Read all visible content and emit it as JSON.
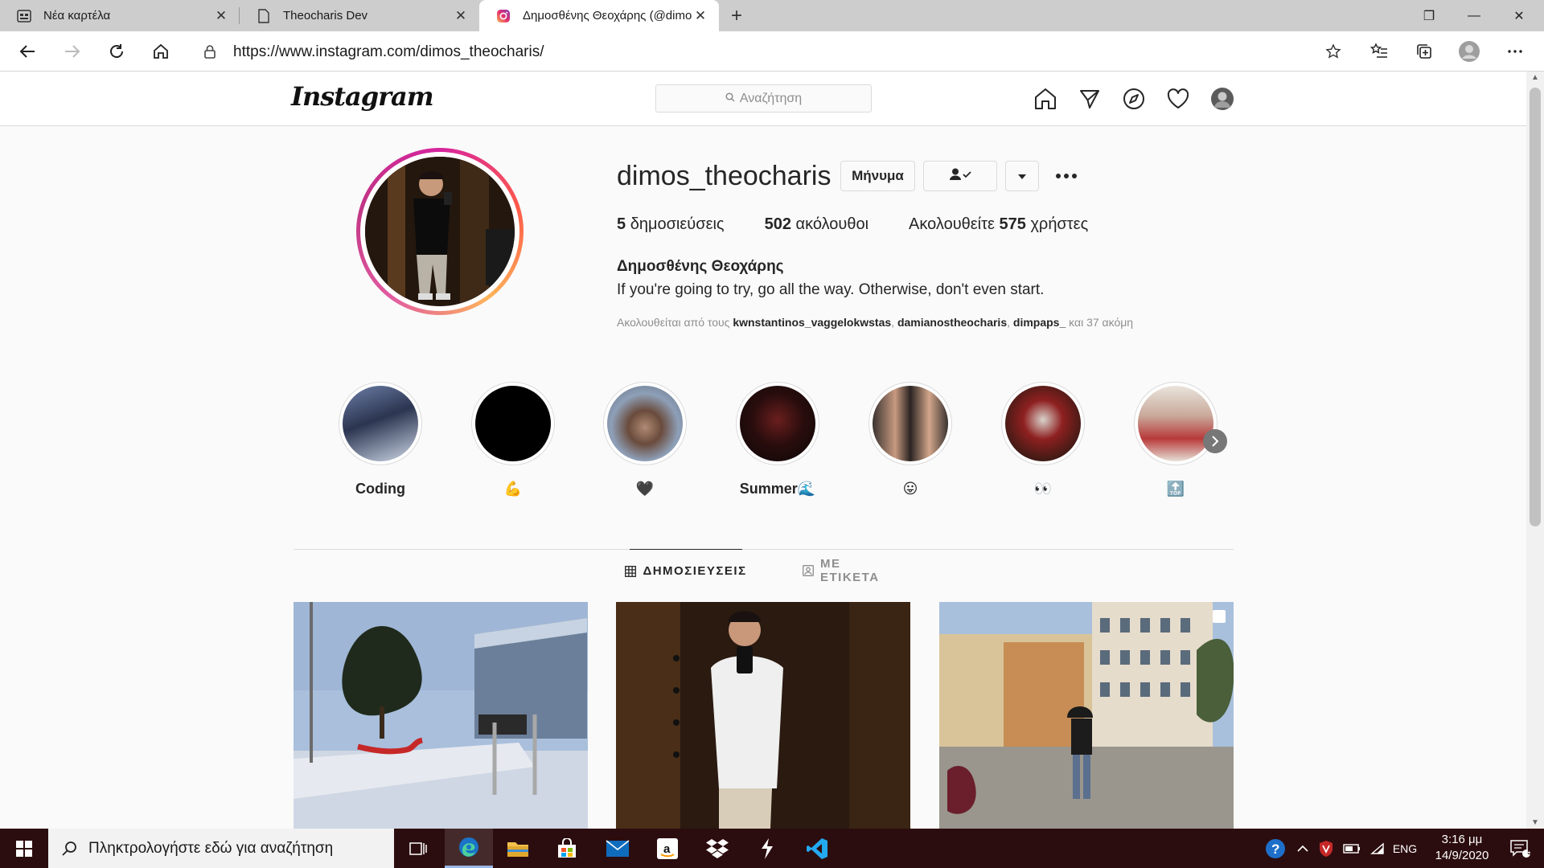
{
  "browser": {
    "tabs": [
      {
        "title": "Νέα καρτέλα",
        "icon": "new-tab-page-icon"
      },
      {
        "title": "Theocharis Dev",
        "icon": "page-icon"
      },
      {
        "title": "Δημοσθένης Θεοχάρης (@dimos_theocharis)",
        "icon": "instagram-icon"
      }
    ],
    "close_glyph": "✕",
    "new_tab_glyph": "+",
    "window_controls": {
      "minimize": "—",
      "maximize": "❐",
      "close": "✕"
    },
    "url": "https://www.instagram.com/dimos_theocharis/"
  },
  "instagram": {
    "logo": "Instagram",
    "search_placeholder": "Αναζήτηση",
    "profile": {
      "username": "dimos_theocharis",
      "message_button": "Μήνυμα",
      "posts_count": "5",
      "posts_label": "δημοσιεύσεις",
      "followers_count": "502",
      "followers_label": "ακόλουθοι",
      "following_prefix": "Ακολουθείτε",
      "following_count": "575",
      "following_suffix": "χρήστες",
      "full_name": "Δημοσθένης Θεοχάρης",
      "bio": "If you're going to try, go all the way. Otherwise, don't even start.",
      "followed_by_prefix": "Ακολουθείται από τους",
      "followed_by_users": [
        "kwnstantinos_vaggelokwstas",
        "damianostheocharis",
        "dimpaps_"
      ],
      "followed_by_suffix": "και 37 ακόμη"
    },
    "highlights": [
      {
        "label": "Coding"
      },
      {
        "label": "💪"
      },
      {
        "label": "🖤"
      },
      {
        "label": "Summer🌊"
      },
      {
        "label": "😛"
      },
      {
        "label": "👀"
      },
      {
        "label": "🔝"
      }
    ],
    "tabs": {
      "posts": "ΔΗΜΟΣΙΕΥΣΕΙΣ",
      "tagged": "ΜΕ ΕΤΙΚΕΤΑ"
    }
  },
  "taskbar": {
    "search_placeholder": "Πληκτρολογήστε εδώ για αναζήτηση",
    "language": "ENG",
    "time": "3:16 μμ",
    "date": "14/9/2020",
    "notification_count": "5"
  },
  "colors": {
    "ig_gradient": [
      "#d6249f",
      "#fd5949",
      "#fdb45a"
    ],
    "taskbar": "#2c0d0f",
    "edge_blue": "#1a73c8"
  }
}
